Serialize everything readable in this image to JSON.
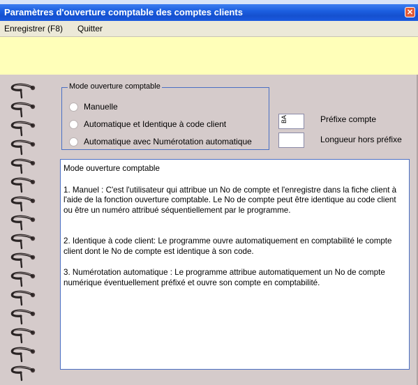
{
  "window": {
    "title": "Paramètres d'ouverture comptable des comptes clients",
    "close_glyph": "✕"
  },
  "menu": {
    "items": [
      "Enregistrer (F8)",
      "Quitter"
    ]
  },
  "mode_group": {
    "legend": "Mode ouverture comptable",
    "options": [
      "Manuelle",
      "Automatique et Identique à code client",
      "Automatique avec Numérotation automatique"
    ]
  },
  "fields": {
    "prefix_value": "BA",
    "prefix_label": "Préfixe compte",
    "length_value": "",
    "length_label": "Longueur hors préfixe"
  },
  "description": {
    "heading": "Mode ouverture comptable",
    "para1": "1. Manuel : C'est l'utilisateur qui attribue un No de compte et l'enregistre dans la fiche client à l'aide de la fonction ouverture comptable.  Le No de compte peut être identique au code client ou être un numéro attribué séquentiellement par le programme.",
    "para2": "2. Identique à code client: Le programme ouvre automatiquement en comptabilité le compte client dont le No de compte est identique à son code.",
    "para3": "3. Numérotation automatique : Le programme attribue automatiquement un No de compte numérique éventuellement préfixé et ouvre son compte en comptabilité."
  },
  "colors": {
    "titlebar": "#1c5fe0",
    "menubar": "#ece9d8",
    "yellow_band": "#ffffb9",
    "panel": "#d5cbcb",
    "accent_border": "#4a6fc4"
  },
  "icons": {
    "close": "close-icon",
    "radio": "radio-button",
    "binding": "spiral-binding"
  }
}
